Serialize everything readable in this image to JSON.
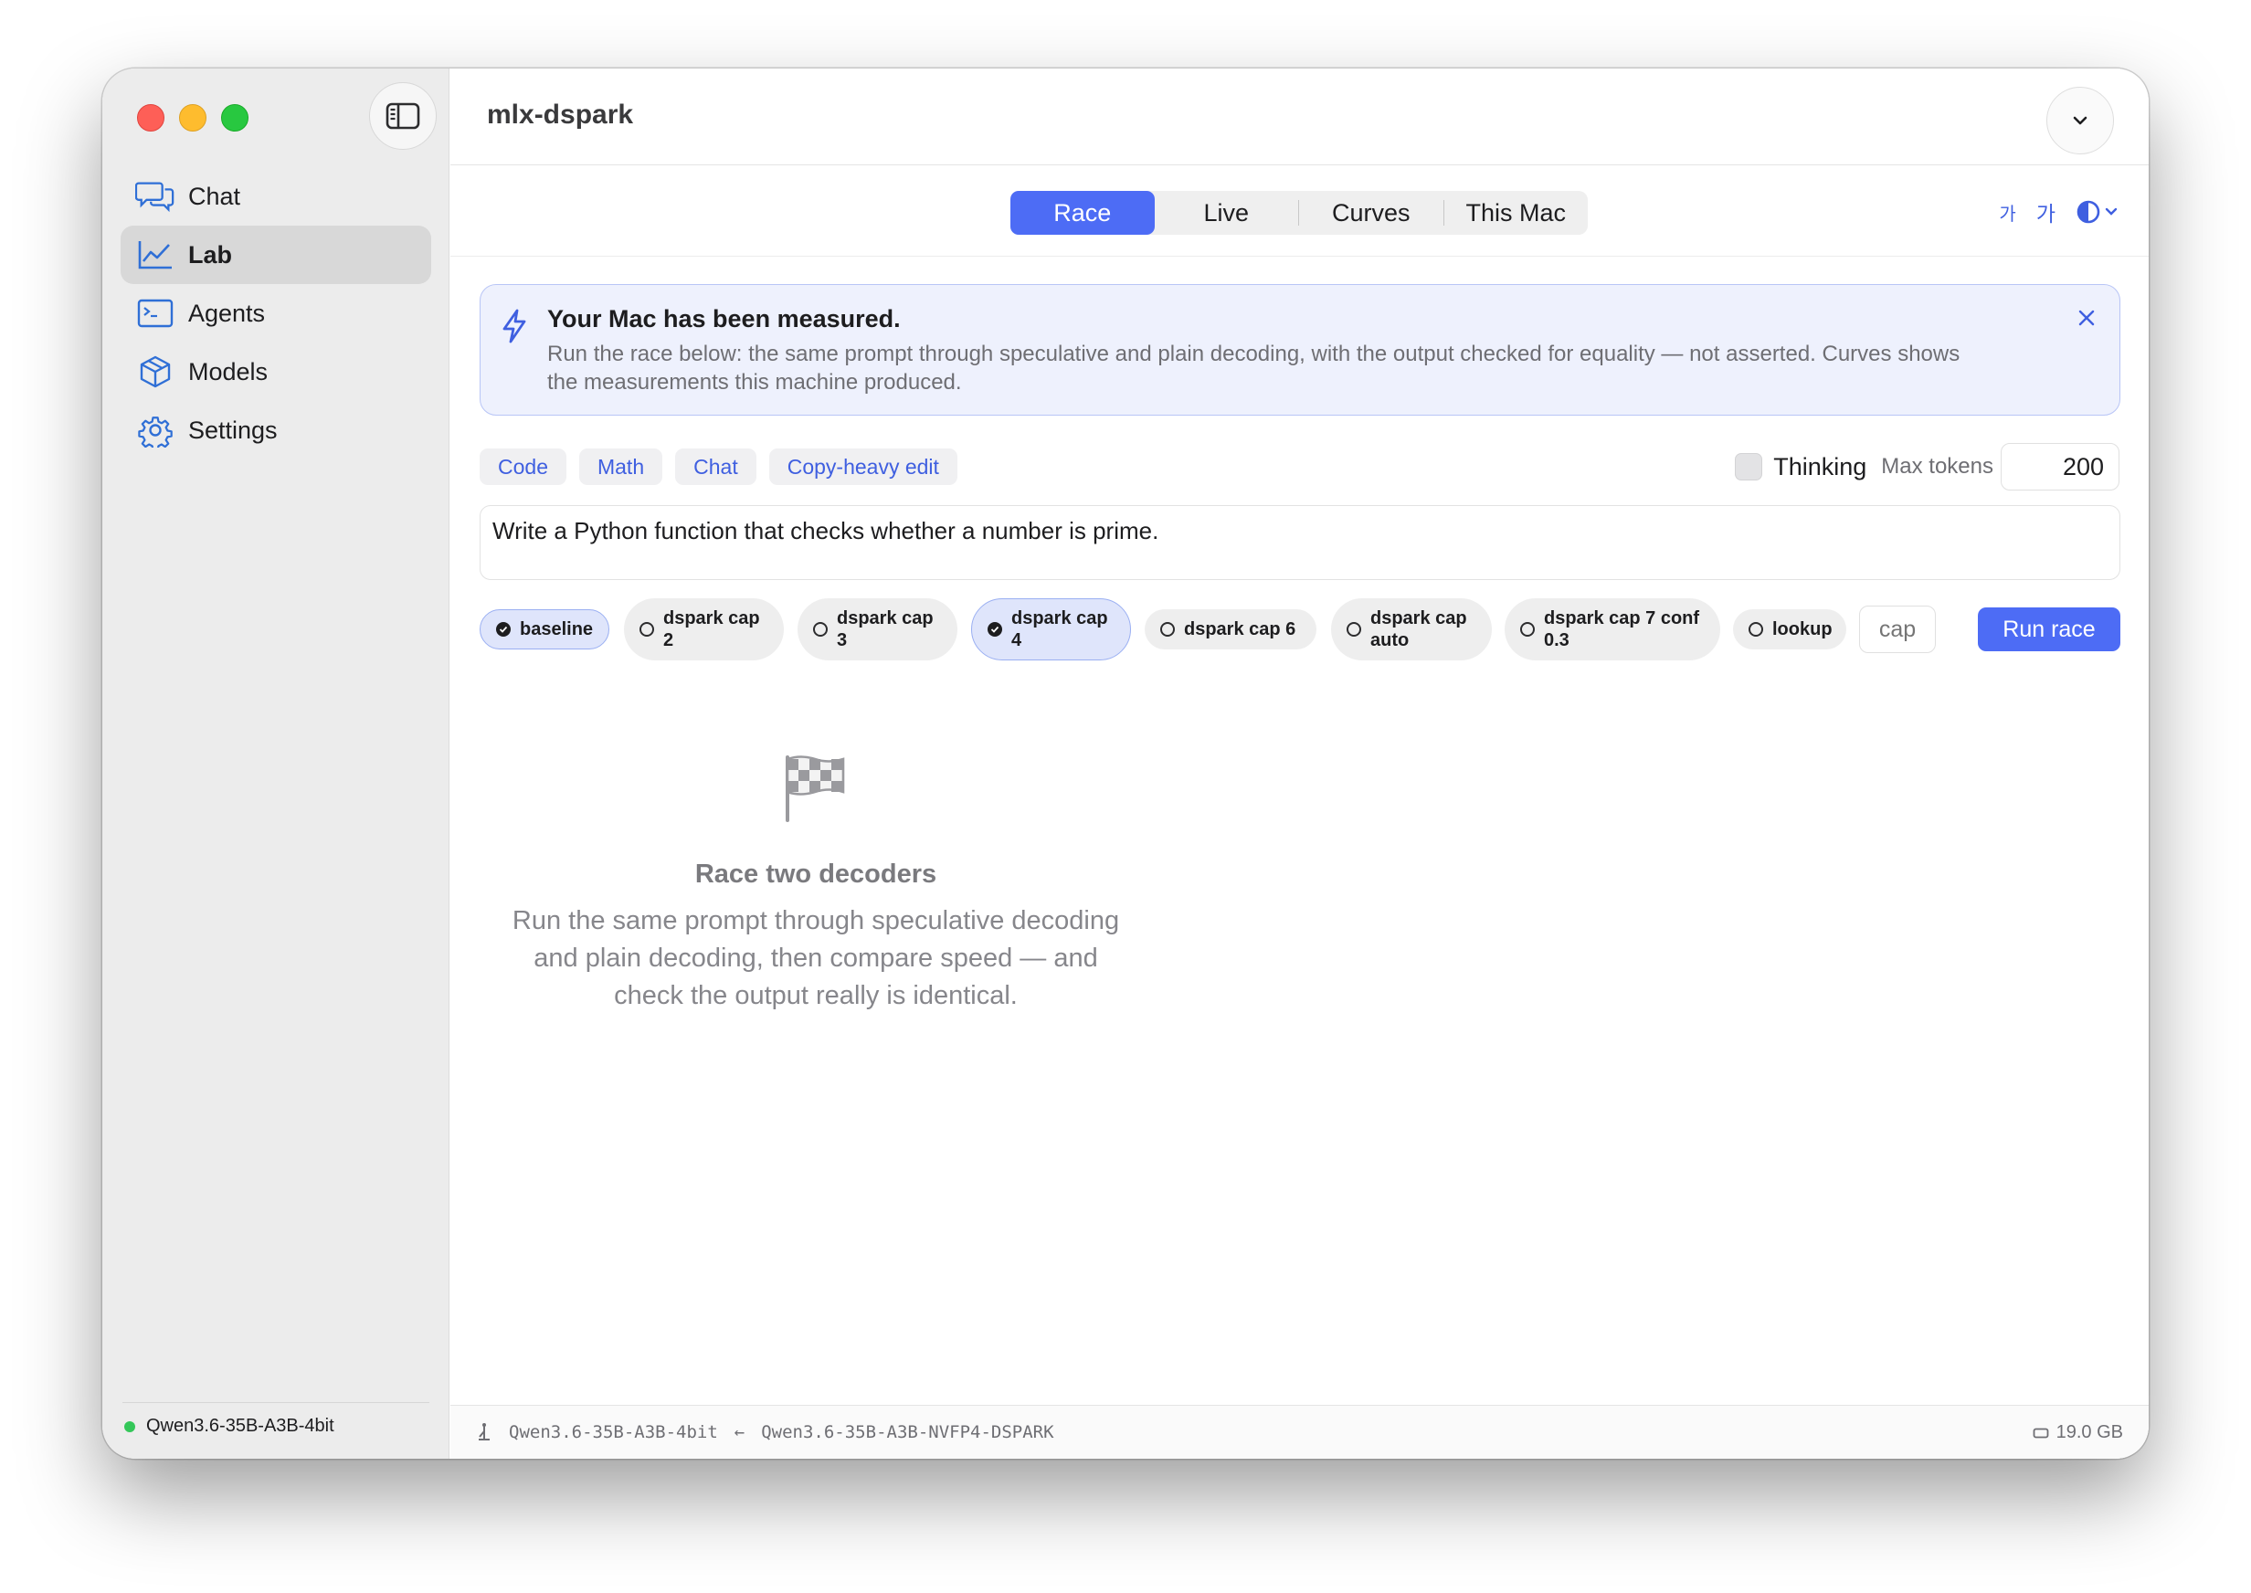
{
  "window": {
    "title": "mlx-dspark"
  },
  "sidebar": {
    "items": [
      {
        "label": "Chat",
        "icon": "chat-bubbles-icon",
        "active": false
      },
      {
        "label": "Lab",
        "icon": "chart-line-icon",
        "active": true
      },
      {
        "label": "Agents",
        "icon": "terminal-icon",
        "active": false
      },
      {
        "label": "Models",
        "icon": "cube-icon",
        "active": false
      },
      {
        "label": "Settings",
        "icon": "gear-icon",
        "active": false
      }
    ],
    "footer_model": "Qwen3.6-35B-A3B-4bit"
  },
  "tabs": {
    "items": [
      "Race",
      "Live",
      "Curves",
      "This Mac"
    ],
    "active": "Race"
  },
  "toolbar": {
    "font_small": "가",
    "font_large": "가"
  },
  "banner": {
    "title": "Your Mac has been measured.",
    "body": "Run the race below: the same prompt through speculative and plain decoding, with the output checked for equality — not asserted. Curves shows the measurements this machine produced."
  },
  "presets": [
    "Code",
    "Math",
    "Chat",
    "Copy-heavy edit"
  ],
  "options": {
    "thinking_label": "Thinking",
    "thinking_checked": false,
    "max_tokens_label": "Max tokens",
    "max_tokens_value": "200"
  },
  "prompt": "Write a Python function that checks whether a number is prime.",
  "variants": [
    {
      "line1": "baseline",
      "line2": "",
      "selected": true
    },
    {
      "line1": "dspark cap",
      "line2": "2",
      "selected": false
    },
    {
      "line1": "dspark cap",
      "line2": "3",
      "selected": false
    },
    {
      "line1": "dspark cap",
      "line2": "4",
      "selected": true
    },
    {
      "line1": "dspark cap 6",
      "line2": "",
      "selected": false
    },
    {
      "line1": "dspark cap",
      "line2": "auto",
      "selected": false
    },
    {
      "line1": "dspark cap 7 conf",
      "line2": "0.3",
      "selected": false
    },
    {
      "line1": "lookup",
      "line2": "",
      "selected": false
    }
  ],
  "cap_placeholder": "cap",
  "run_button": "Run race",
  "empty_state": {
    "title": "Race two decoders",
    "body": "Run the same prompt through speculative decoding and plain decoding, then compare speed — and check the output really is identical."
  },
  "statusbar": {
    "target_model": "Qwen3.6-35B-A3B-4bit",
    "draft_model": "Qwen3.6-35B-A3B-NVFP4-DSPARK",
    "memory": "19.0 GB"
  },
  "colors": {
    "accent": "#4d6cf5",
    "banner_bg": "#eef1fd",
    "status_green": "#34c759"
  }
}
